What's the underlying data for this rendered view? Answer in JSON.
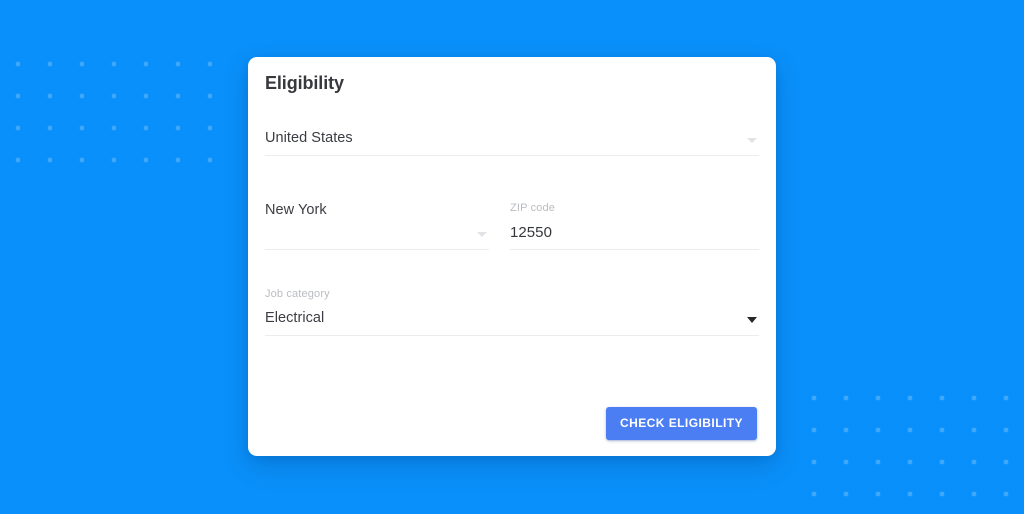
{
  "theme": {
    "background_color": "#0a90fa",
    "card_background": "#ffffff",
    "accent_color": "#4c7ef3",
    "label_color": "#b9bcc1",
    "value_color": "#3b3d42",
    "underline_color": "#ebecee",
    "dot_color": "rgba(255,255,255,0.22)"
  },
  "card": {
    "title": "Eligibility",
    "fields": {
      "country": {
        "label": "",
        "value": "United States",
        "icon": "chevron-down-icon"
      },
      "state": {
        "label": "",
        "value": "New York",
        "icon": "chevron-down-icon"
      },
      "zip": {
        "label": "ZIP code",
        "value": "12550",
        "placeholder": "ZIP code"
      },
      "job_category": {
        "label": "Job category",
        "value": "Electrical",
        "icon": "chevron-down-icon"
      }
    },
    "action": {
      "submit_label": "CHECK ELIGIBILITY"
    }
  }
}
